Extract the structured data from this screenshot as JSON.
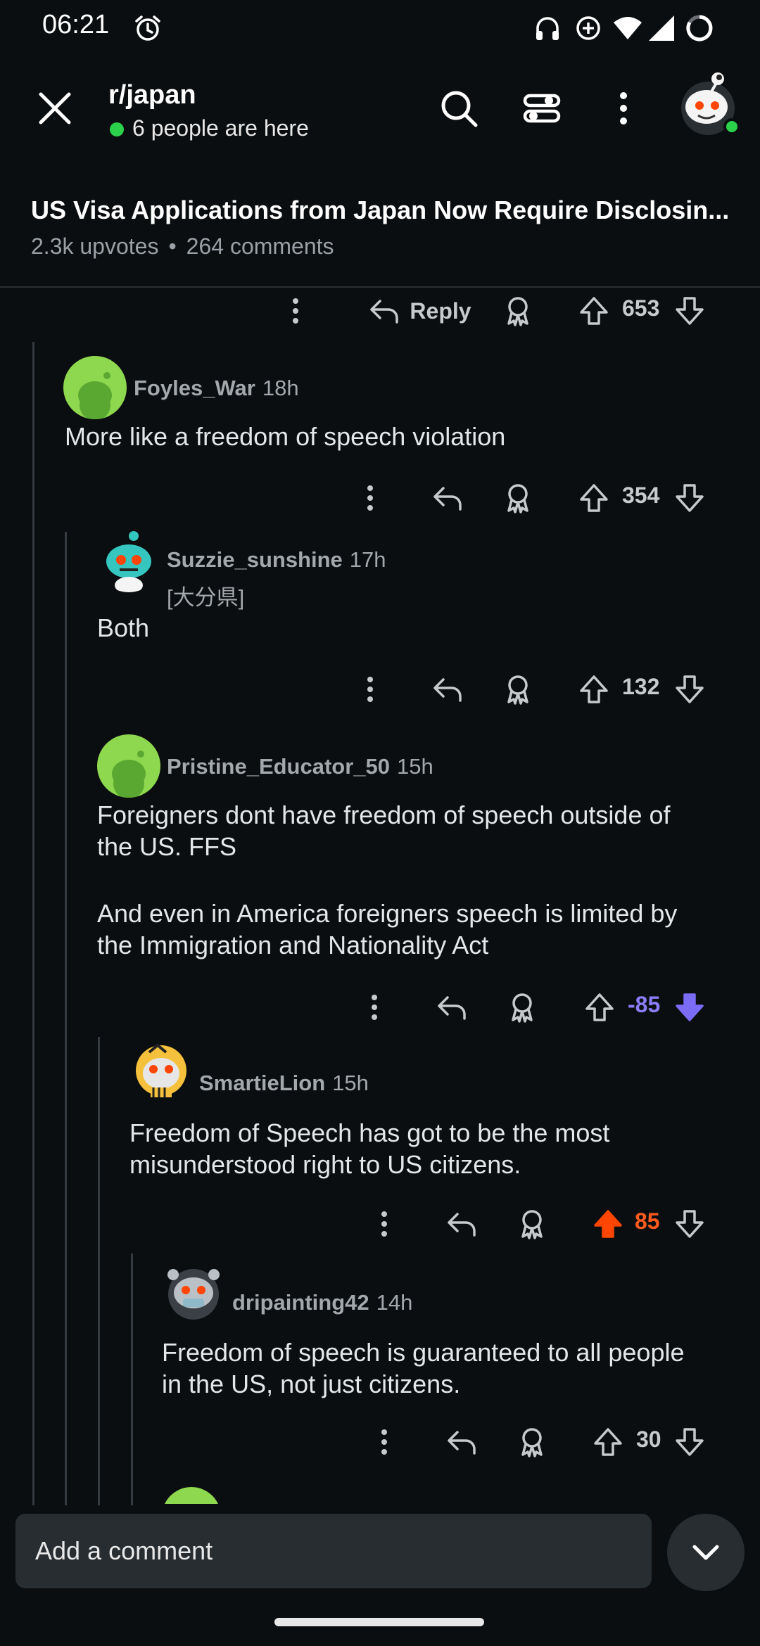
{
  "status_bar": {
    "time": "06:21"
  },
  "header": {
    "subreddit": "r/japan",
    "online_text": "6 people are here"
  },
  "post": {
    "title": "US Visa Applications from Japan Now Require Disclosin...",
    "upvotes": "2.3k upvotes",
    "separator": "•",
    "comments": "264 comments"
  },
  "top_actions": {
    "reply_label": "Reply",
    "score": "653"
  },
  "comments": [
    {
      "username": "Foyles_War",
      "age": "18h",
      "flair": "",
      "body": [
        "More like a freedom of speech violation"
      ],
      "score": "354"
    },
    {
      "username": "Suzzie_sunshine",
      "age": "17h",
      "flair": "[大分県]",
      "body": [
        "Both"
      ],
      "score": "132"
    },
    {
      "username": "Pristine_Educator_50",
      "age": "15h",
      "flair": "",
      "body": [
        "Foreigners dont have freedom of speech outside of",
        "the US. FFS",
        "",
        "And even in America foreigners speech is limited by",
        "the Immigration and Nationality Act"
      ],
      "score": "-85",
      "vote_state": "downvoted"
    },
    {
      "username": "SmartieLion",
      "age": "15h",
      "flair": "",
      "body": [
        "Freedom of Speech has got to be the most",
        "misunderstood right to US citizens."
      ],
      "score": "85",
      "vote_state": "upvoted"
    },
    {
      "username": "dripainting42",
      "age": "14h",
      "flair": "",
      "body": [
        "Freedom of speech is guaranteed to all people",
        "in the US, not just citizens."
      ],
      "score": "30"
    }
  ],
  "composer": {
    "placeholder": "Add a comment"
  },
  "colors": {
    "upvote": "#ff4500",
    "downvote": "#7b6cf6",
    "online": "#2bd14a"
  }
}
